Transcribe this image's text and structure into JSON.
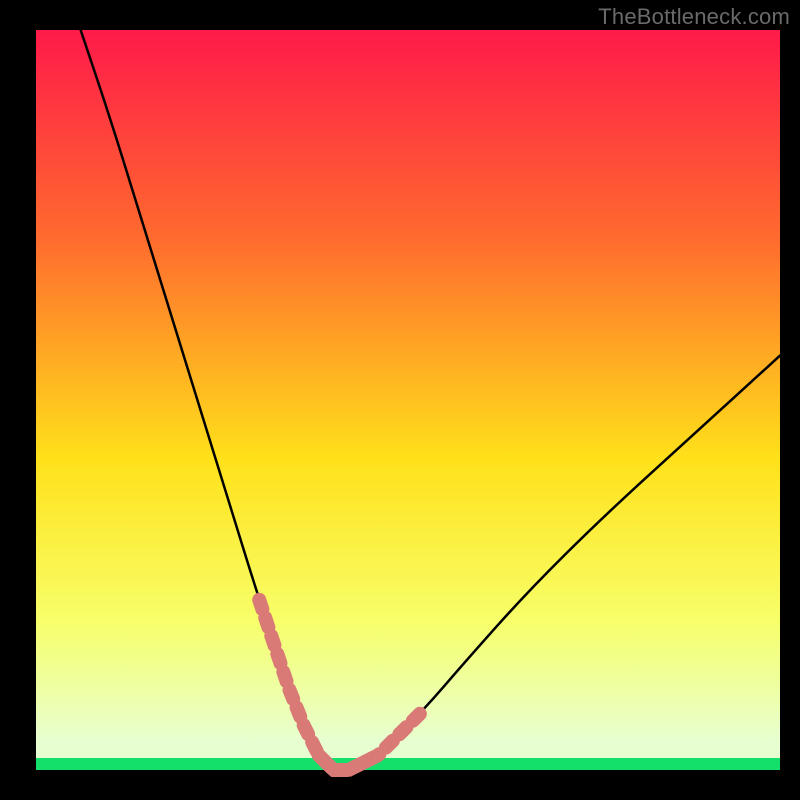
{
  "watermark": "TheBottleneck.com",
  "colors": {
    "frame": "#000000",
    "grad_top": "#ff1a4a",
    "grad_q1": "#ff6a2e",
    "grad_mid": "#ffe11a",
    "grad_q3": "#f7ff6a",
    "grad_bot_inner": "#e7ffd0",
    "grad_bottom_strip": "#12e06a",
    "curve": "#000000",
    "marker": "#d97a77",
    "watermark": "#6a6a6a"
  },
  "chart_data": {
    "type": "line",
    "title": "",
    "xlabel": "",
    "ylabel": "",
    "xlim": [
      0,
      100
    ],
    "ylim": [
      0,
      100
    ],
    "series": [
      {
        "name": "bottleneck-curve",
        "x": [
          6,
          10,
          14,
          18,
          22,
          26,
          30,
          34,
          36,
          38,
          40,
          42,
          46,
          52,
          58,
          66,
          76,
          88,
          100
        ],
        "y": [
          100,
          88,
          75,
          62,
          49,
          36,
          23,
          11,
          6,
          2,
          0,
          0,
          2,
          8,
          15,
          24,
          34,
          45,
          56
        ]
      }
    ],
    "highlighted_segments": [
      {
        "name": "left-descent-near-min",
        "x_range": [
          30,
          38
        ]
      },
      {
        "name": "minimum-flat",
        "x_range": [
          38,
          45
        ]
      },
      {
        "name": "right-ascent-near-min",
        "x_range": [
          45,
          52
        ]
      }
    ],
    "annotations": []
  }
}
